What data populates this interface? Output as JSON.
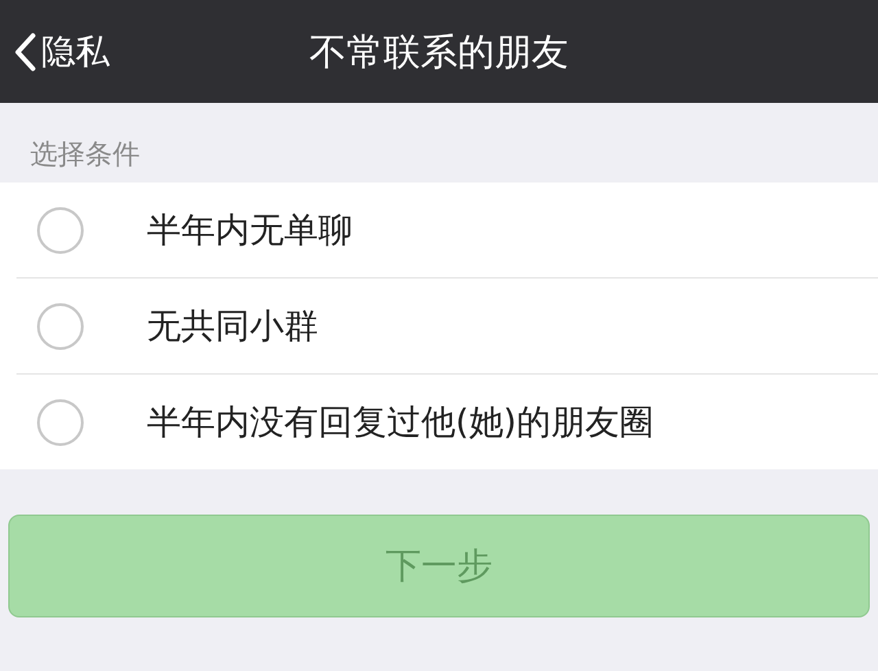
{
  "nav_bar": {
    "back_label": "隐私",
    "title": "不常联系的朋友"
  },
  "section_label": "选择条件",
  "options": [
    {
      "label": "半年内无单聊",
      "selected": false
    },
    {
      "label": "无共同小群",
      "selected": false
    },
    {
      "label": "半年内没有回复过他(她)的朋友圈",
      "selected": false
    }
  ],
  "next_button": {
    "label": "下一步",
    "disabled": true
  }
}
